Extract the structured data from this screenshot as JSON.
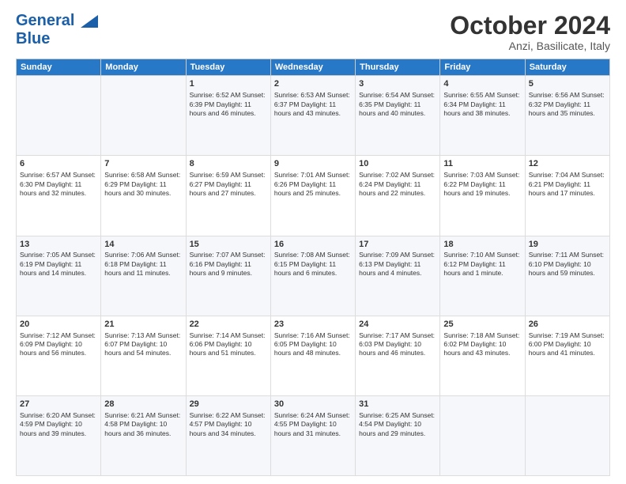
{
  "header": {
    "logo_line1": "General",
    "logo_line2": "Blue",
    "month": "October 2024",
    "location": "Anzi, Basilicate, Italy"
  },
  "days_of_week": [
    "Sunday",
    "Monday",
    "Tuesday",
    "Wednesday",
    "Thursday",
    "Friday",
    "Saturday"
  ],
  "weeks": [
    [
      {
        "day": "",
        "content": ""
      },
      {
        "day": "",
        "content": ""
      },
      {
        "day": "1",
        "content": "Sunrise: 6:52 AM\nSunset: 6:39 PM\nDaylight: 11 hours and 46 minutes."
      },
      {
        "day": "2",
        "content": "Sunrise: 6:53 AM\nSunset: 6:37 PM\nDaylight: 11 hours and 43 minutes."
      },
      {
        "day": "3",
        "content": "Sunrise: 6:54 AM\nSunset: 6:35 PM\nDaylight: 11 hours and 40 minutes."
      },
      {
        "day": "4",
        "content": "Sunrise: 6:55 AM\nSunset: 6:34 PM\nDaylight: 11 hours and 38 minutes."
      },
      {
        "day": "5",
        "content": "Sunrise: 6:56 AM\nSunset: 6:32 PM\nDaylight: 11 hours and 35 minutes."
      }
    ],
    [
      {
        "day": "6",
        "content": "Sunrise: 6:57 AM\nSunset: 6:30 PM\nDaylight: 11 hours and 32 minutes."
      },
      {
        "day": "7",
        "content": "Sunrise: 6:58 AM\nSunset: 6:29 PM\nDaylight: 11 hours and 30 minutes."
      },
      {
        "day": "8",
        "content": "Sunrise: 6:59 AM\nSunset: 6:27 PM\nDaylight: 11 hours and 27 minutes."
      },
      {
        "day": "9",
        "content": "Sunrise: 7:01 AM\nSunset: 6:26 PM\nDaylight: 11 hours and 25 minutes."
      },
      {
        "day": "10",
        "content": "Sunrise: 7:02 AM\nSunset: 6:24 PM\nDaylight: 11 hours and 22 minutes."
      },
      {
        "day": "11",
        "content": "Sunrise: 7:03 AM\nSunset: 6:22 PM\nDaylight: 11 hours and 19 minutes."
      },
      {
        "day": "12",
        "content": "Sunrise: 7:04 AM\nSunset: 6:21 PM\nDaylight: 11 hours and 17 minutes."
      }
    ],
    [
      {
        "day": "13",
        "content": "Sunrise: 7:05 AM\nSunset: 6:19 PM\nDaylight: 11 hours and 14 minutes."
      },
      {
        "day": "14",
        "content": "Sunrise: 7:06 AM\nSunset: 6:18 PM\nDaylight: 11 hours and 11 minutes."
      },
      {
        "day": "15",
        "content": "Sunrise: 7:07 AM\nSunset: 6:16 PM\nDaylight: 11 hours and 9 minutes."
      },
      {
        "day": "16",
        "content": "Sunrise: 7:08 AM\nSunset: 6:15 PM\nDaylight: 11 hours and 6 minutes."
      },
      {
        "day": "17",
        "content": "Sunrise: 7:09 AM\nSunset: 6:13 PM\nDaylight: 11 hours and 4 minutes."
      },
      {
        "day": "18",
        "content": "Sunrise: 7:10 AM\nSunset: 6:12 PM\nDaylight: 11 hours and 1 minute."
      },
      {
        "day": "19",
        "content": "Sunrise: 7:11 AM\nSunset: 6:10 PM\nDaylight: 10 hours and 59 minutes."
      }
    ],
    [
      {
        "day": "20",
        "content": "Sunrise: 7:12 AM\nSunset: 6:09 PM\nDaylight: 10 hours and 56 minutes."
      },
      {
        "day": "21",
        "content": "Sunrise: 7:13 AM\nSunset: 6:07 PM\nDaylight: 10 hours and 54 minutes."
      },
      {
        "day": "22",
        "content": "Sunrise: 7:14 AM\nSunset: 6:06 PM\nDaylight: 10 hours and 51 minutes."
      },
      {
        "day": "23",
        "content": "Sunrise: 7:16 AM\nSunset: 6:05 PM\nDaylight: 10 hours and 48 minutes."
      },
      {
        "day": "24",
        "content": "Sunrise: 7:17 AM\nSunset: 6:03 PM\nDaylight: 10 hours and 46 minutes."
      },
      {
        "day": "25",
        "content": "Sunrise: 7:18 AM\nSunset: 6:02 PM\nDaylight: 10 hours and 43 minutes."
      },
      {
        "day": "26",
        "content": "Sunrise: 7:19 AM\nSunset: 6:00 PM\nDaylight: 10 hours and 41 minutes."
      }
    ],
    [
      {
        "day": "27",
        "content": "Sunrise: 6:20 AM\nSunset: 4:59 PM\nDaylight: 10 hours and 39 minutes."
      },
      {
        "day": "28",
        "content": "Sunrise: 6:21 AM\nSunset: 4:58 PM\nDaylight: 10 hours and 36 minutes."
      },
      {
        "day": "29",
        "content": "Sunrise: 6:22 AM\nSunset: 4:57 PM\nDaylight: 10 hours and 34 minutes."
      },
      {
        "day": "30",
        "content": "Sunrise: 6:24 AM\nSunset: 4:55 PM\nDaylight: 10 hours and 31 minutes."
      },
      {
        "day": "31",
        "content": "Sunrise: 6:25 AM\nSunset: 4:54 PM\nDaylight: 10 hours and 29 minutes."
      },
      {
        "day": "",
        "content": ""
      },
      {
        "day": "",
        "content": ""
      }
    ]
  ]
}
